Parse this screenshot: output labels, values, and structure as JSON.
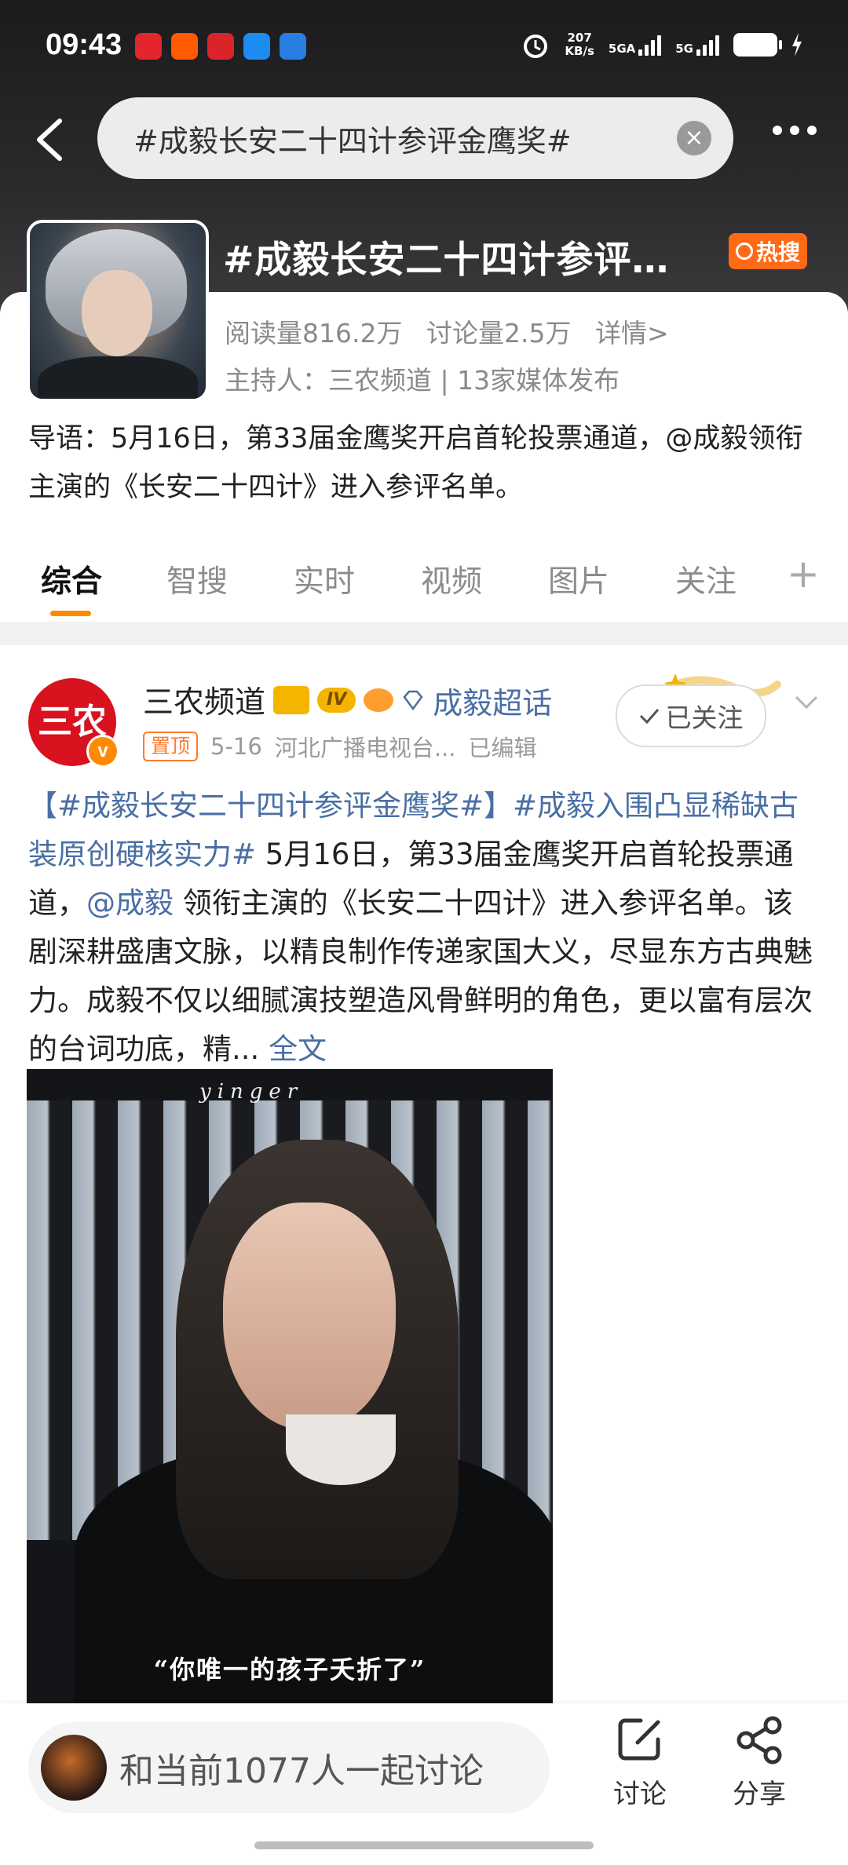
{
  "status_bar": {
    "time": "09:43",
    "net_speed": "207",
    "net_unit": "KB/s",
    "sig1": "5GA",
    "sig2": "5G"
  },
  "search": {
    "query": "#成毅长安二十四计参评金鹰奖#"
  },
  "topic": {
    "title": "#成毅长安二十四计参评…",
    "hot_badge": "热搜",
    "reads": "阅读量816.2万",
    "discussions": "讨论量2.5万",
    "details": "详情>",
    "host": "主持人：三农频道 | 13家媒体发布",
    "intro": "导语：5月16日，第33届金鹰奖开启首轮投票通道，@成毅领衔主演的《长安二十四计》进入参评名单。"
  },
  "tabs": [
    {
      "label": "综合"
    },
    {
      "label": "智搜"
    },
    {
      "label": "实时"
    },
    {
      "label": "视频"
    },
    {
      "label": "图片"
    },
    {
      "label": "关注"
    }
  ],
  "post": {
    "avatar_text": "三农",
    "author": "三农频道",
    "level": "IV",
    "supertopic": "成毅超话",
    "pinned": "置顶",
    "date": "5-16",
    "source": "河北广播电视台...",
    "edited": "已编辑",
    "follow_label": "已关注",
    "tag1": "【#成毅长安二十四计参评金鹰奖#】",
    "tag2": "#成毅入围凸显稀缺古装原创硬核实力#",
    "text1": " 5月16日，第33届金鹰奖开启首轮投票通道，",
    "mention": "@成毅",
    "text2": " 领衔主演的《长安二十四计》进入参评名单。该剧深耕盛唐文脉，以精良制作传递家国大义，尽显东方古典魅力。成毅不仅以细腻演技塑造风骨鲜明的角色，更以富有层次的台词功底，精...",
    "full_text": "全文",
    "image_watermark": "yinger",
    "image_caption": "“你唯一的孩子夭折了”"
  },
  "bottom_bar": {
    "discuss_prompt": "和当前1077人一起讨论",
    "discuss_label": "讨论",
    "share_label": "分享"
  }
}
